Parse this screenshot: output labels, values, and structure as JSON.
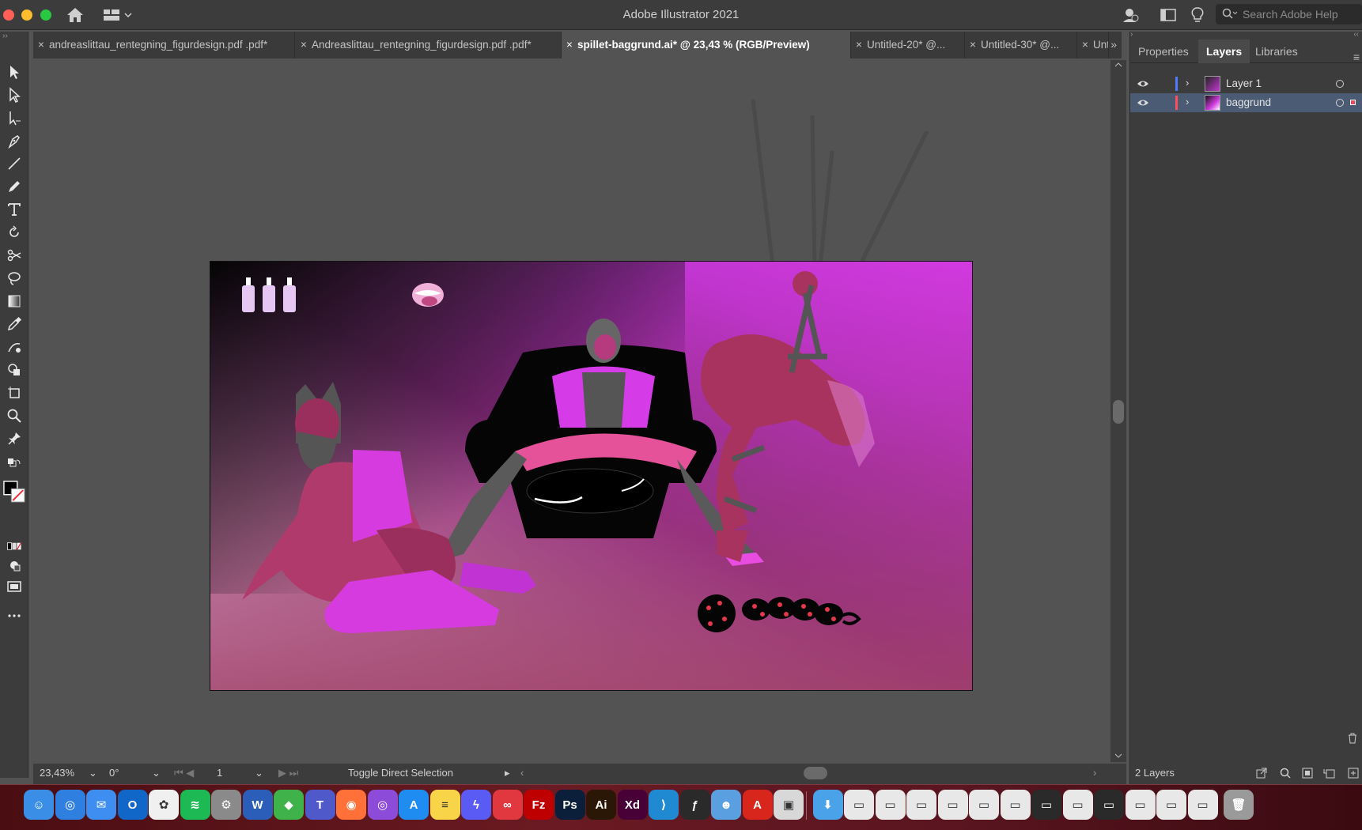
{
  "app": {
    "title": "Adobe Illustrator 2021",
    "search_placeholder": "Search Adobe Help"
  },
  "tabs": [
    {
      "label": "andreaslittau_rentegning_figurdesign.pdf .pdf*",
      "active": false
    },
    {
      "label": "Andreaslittau_rentegning_figurdesign.pdf .pdf*",
      "active": false
    },
    {
      "label": "spillet-baggrund.ai* @ 23,43 % (RGB/Preview)",
      "active": true
    },
    {
      "label": "Untitled-20* @...",
      "active": false
    },
    {
      "label": "Untitled-30* @...",
      "active": false
    },
    {
      "label": "Unt",
      "active": false
    }
  ],
  "panel": {
    "tabs": [
      "Properties",
      "Layers",
      "Libraries"
    ],
    "active_tab": "Layers",
    "layers": [
      {
        "name": "Layer 1",
        "color": "#4f7cff",
        "selected": false
      },
      {
        "name": "baggrund",
        "color": "#ff4f5a",
        "selected": true
      }
    ],
    "footer_count": "2 Layers"
  },
  "status": {
    "zoom": "23,43%",
    "rotation": "0°",
    "artboard": "1",
    "tool_hint": "Toggle Direct Selection"
  },
  "tools": [
    "selection-tool",
    "direct-selection-tool",
    "group-selection-tool",
    "pen-tool",
    "line-tool",
    "pencil-tool",
    "type-tool",
    "rotate-tool",
    "scissors-tool",
    "lasso-tool",
    "gradient-tool",
    "eyedropper-tool",
    "blend-tool",
    "shape-builder-tool",
    "artboard-tool",
    "zoom-tool",
    "pin-tool"
  ],
  "colors": {
    "accent_selected": "#4b5b73",
    "artboard_magenta": "#c93ad6"
  },
  "dock": [
    {
      "name": "finder",
      "color": "#3a8ee6",
      "glyph": "☺"
    },
    {
      "name": "safari",
      "color": "#2f7fe0",
      "glyph": "◎"
    },
    {
      "name": "mail",
      "color": "#3d8ef0",
      "glyph": "✉"
    },
    {
      "name": "outlook",
      "color": "#1167c7",
      "glyph": "O"
    },
    {
      "name": "photos",
      "color": "#f0f0f0",
      "glyph": "✿"
    },
    {
      "name": "spotify",
      "color": "#1db954",
      "glyph": "≋"
    },
    {
      "name": "system-preferences",
      "color": "#8a8a8a",
      "glyph": "⚙"
    },
    {
      "name": "word",
      "color": "#2b5eb8",
      "glyph": "W"
    },
    {
      "name": "sims",
      "color": "#3fb24a",
      "glyph": "◆"
    },
    {
      "name": "teams",
      "color": "#5059c9",
      "glyph": "T"
    },
    {
      "name": "firefox",
      "color": "#ff7139",
      "glyph": "◉"
    },
    {
      "name": "podcasts",
      "color": "#8c4bd9",
      "glyph": "◎"
    },
    {
      "name": "app-store",
      "color": "#1e8cf0",
      "glyph": "A"
    },
    {
      "name": "notes",
      "color": "#f7d448",
      "glyph": "≡"
    },
    {
      "name": "messenger",
      "color": "#5a5af5",
      "glyph": "ϟ"
    },
    {
      "name": "creative-cloud",
      "color": "#e0383e",
      "glyph": "∞"
    },
    {
      "name": "filezilla",
      "color": "#bf0000",
      "glyph": "Fz"
    },
    {
      "name": "photoshop",
      "color": "#0b1f3a",
      "glyph": "Ps"
    },
    {
      "name": "illustrator",
      "color": "#2a1705",
      "glyph": "Ai"
    },
    {
      "name": "xd",
      "color": "#470137",
      "glyph": "Xd"
    },
    {
      "name": "vscode",
      "color": "#1f8ad2",
      "glyph": "⟩"
    },
    {
      "name": "script-editor",
      "color": "#2a2a2a",
      "glyph": "ƒ"
    },
    {
      "name": "avatar-app",
      "color": "#5aa0e0",
      "glyph": "☻"
    },
    {
      "name": "acrobat",
      "color": "#d9261c",
      "glyph": "A"
    },
    {
      "name": "preview",
      "color": "#d8d8d8",
      "glyph": "▣"
    },
    {
      "name": "downloads-folder",
      "color": "#4aa3e8",
      "glyph": "⬇"
    },
    {
      "name": "window-1",
      "color": "#e8e8e8",
      "glyph": "▭"
    },
    {
      "name": "window-2",
      "color": "#e8e8e8",
      "glyph": "▭"
    },
    {
      "name": "window-3",
      "color": "#e8e8e8",
      "glyph": "▭"
    },
    {
      "name": "window-4",
      "color": "#e8e8e8",
      "glyph": "▭"
    },
    {
      "name": "window-5",
      "color": "#e8e8e8",
      "glyph": "▭"
    },
    {
      "name": "window-6",
      "color": "#e8e8e8",
      "glyph": "▭"
    },
    {
      "name": "window-7",
      "color": "#2a2a2a",
      "glyph": "▭"
    },
    {
      "name": "window-8",
      "color": "#e8e8e8",
      "glyph": "▭"
    },
    {
      "name": "window-9",
      "color": "#2a2a2a",
      "glyph": "▭"
    },
    {
      "name": "window-10",
      "color": "#e8e8e8",
      "glyph": "▭"
    },
    {
      "name": "window-11",
      "color": "#e8e8e8",
      "glyph": "▭"
    },
    {
      "name": "window-12",
      "color": "#e8e8e8",
      "glyph": "▭"
    },
    {
      "name": "trash",
      "color": "#9a9a9a",
      "glyph": "🗑"
    }
  ]
}
